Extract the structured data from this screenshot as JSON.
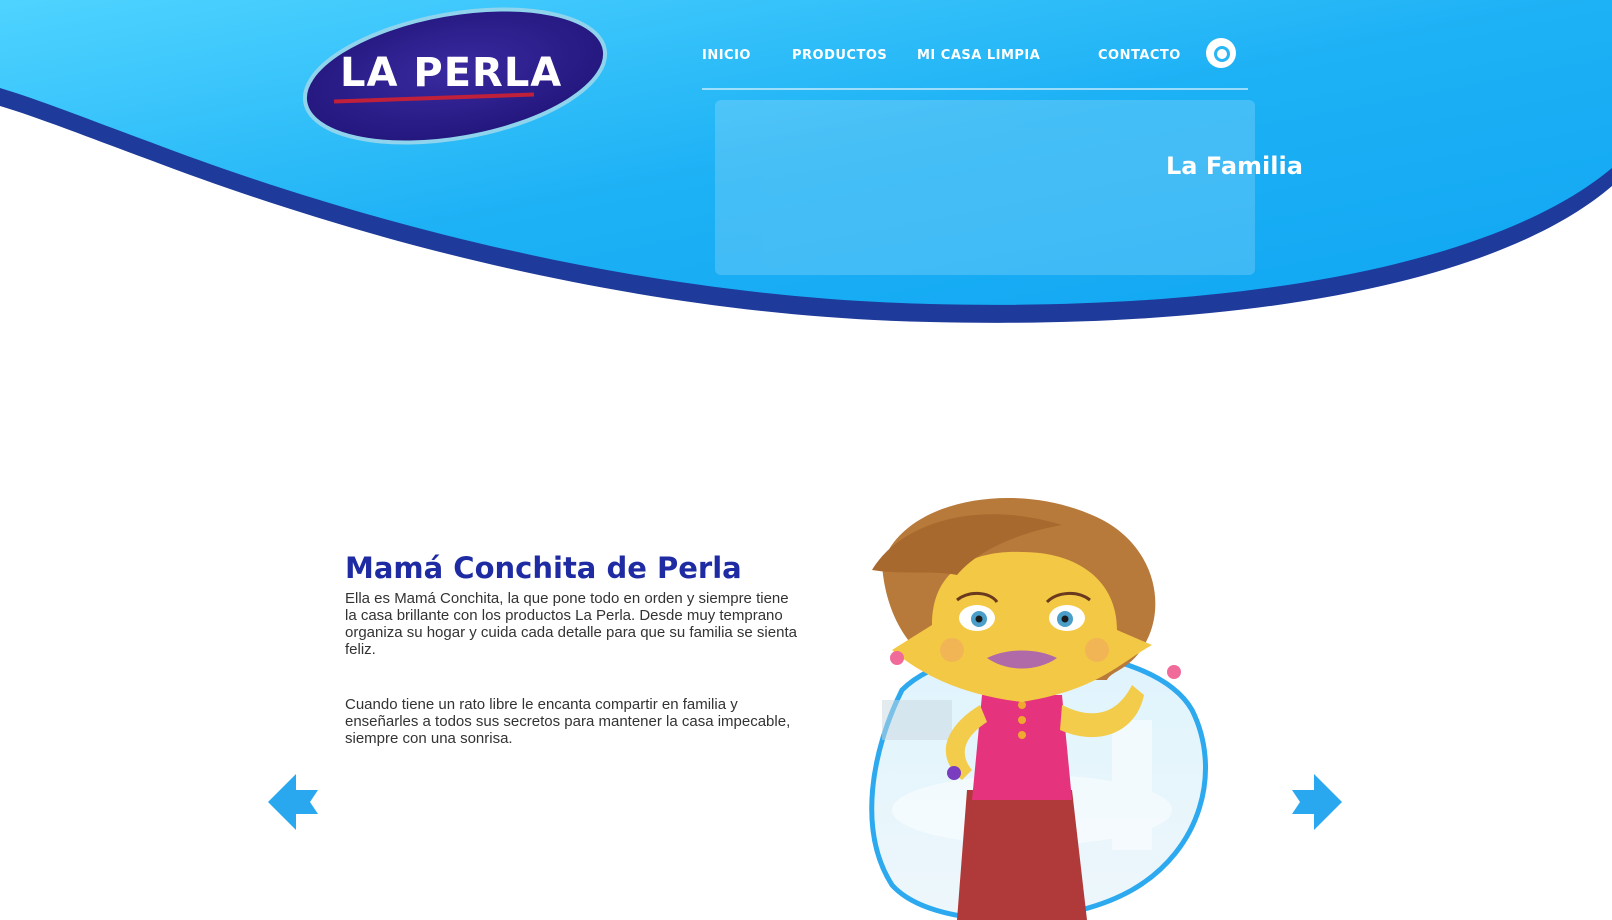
{
  "brand": {
    "logo_text": "LA PERLA",
    "logo_colors": {
      "oval": "#2a1c8a",
      "ring": "#7ec8e3",
      "stripe": "#c0203a"
    }
  },
  "header": {
    "background_colors": {
      "light": "#4fd3ff",
      "main": "#1db1f5",
      "dark": "#1e3a9a"
    },
    "nav": {
      "items": [
        {
          "label": "Inicio"
        },
        {
          "label": "Productos"
        },
        {
          "label": "Mi casa limpia"
        },
        {
          "label": "Contacto"
        }
      ],
      "search_icon": "search-icon"
    },
    "hero_label": "La Familia"
  },
  "main": {
    "title": "Mamá Conchita de Perla",
    "paragraphs": [
      "Ella es Mamá Conchita, la que pone todo en orden y siempre tiene la casa brillante con los productos La Perla. Desde muy temprano organiza su hogar y cuida cada detalle para que su familia se sienta feliz.",
      "Cuando tiene un rato libre le encanta compartir en familia y enseñarles a todos sus secretos para mantener la casa impecable, siempre con una sonrisa."
    ],
    "carousel": {
      "prev_icon": "arrow-left-icon",
      "next_icon": "arrow-right-icon",
      "accent": "#29a8f0"
    },
    "character_icon": "character-illustration"
  }
}
